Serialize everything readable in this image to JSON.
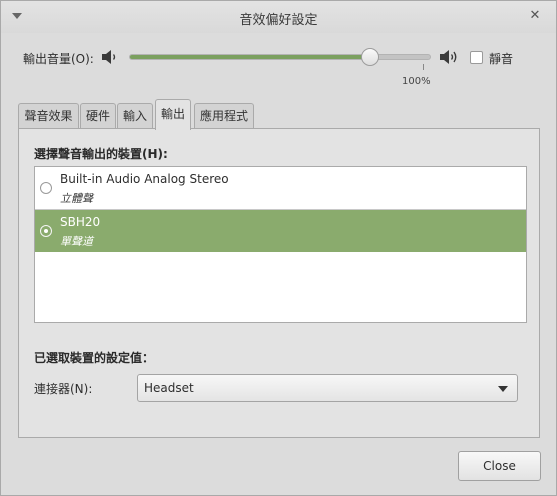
{
  "window": {
    "title": "音效偏好設定",
    "menu_icon": "chevron-down-icon",
    "close_icon": "close-icon",
    "close_glyph": "✕"
  },
  "volume": {
    "label": "輸出音量(O):",
    "level_percent": 80,
    "tick_label": "100%",
    "tick_percent": 97,
    "mute_label": "靜音",
    "muted": false,
    "accent_color": "#7ba05f"
  },
  "tabs": [
    {
      "label": "聲音效果",
      "active": false
    },
    {
      "label": "硬件",
      "active": false
    },
    {
      "label": "輸入",
      "active": false
    },
    {
      "label": "輸出",
      "active": true
    },
    {
      "label": "應用程式",
      "active": false
    }
  ],
  "output": {
    "device_heading": "選擇聲音輸出的裝置(H):",
    "devices": [
      {
        "name": "Built-in Audio Analog Stereo",
        "profile": "立體聲",
        "selected": false
      },
      {
        "name": "SBH20",
        "profile": "單聲道",
        "selected": true
      }
    ],
    "selection_color": "#8aab6d",
    "settings_heading": "已選取裝置的設定值：",
    "connector_label": "連接器(N):",
    "connector_value": "Headset"
  },
  "footer": {
    "close_label": "Close"
  }
}
